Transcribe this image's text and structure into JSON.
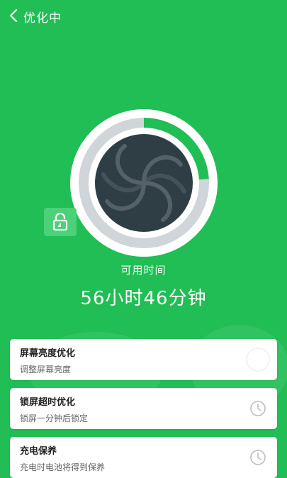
{
  "header": {
    "title": "优化中",
    "back_icon": "chevron-left-icon"
  },
  "gauge": {
    "progress_fraction": 0.24,
    "ring_color": "#ffffff",
    "track_color": "#cfd5d9",
    "center_color": "#2f3d45",
    "center_icon": "swirl-icon",
    "badge_icon": "lock-icon"
  },
  "status": {
    "label": "可用时间",
    "value": "56小时46分钟"
  },
  "items": [
    {
      "title": "屏幕亮度优化",
      "desc": "调整屏幕亮度",
      "status_icon": "loading-ring-icon"
    },
    {
      "title": "锁屏超时优化",
      "desc": "锁屏一分钟后锁定",
      "status_icon": "clock-icon"
    },
    {
      "title": "充电保养",
      "desc": "充电时电池将得到保养",
      "status_icon": "clock-icon"
    }
  ],
  "colors": {
    "background": "#21bd55",
    "card": "#ffffff"
  }
}
